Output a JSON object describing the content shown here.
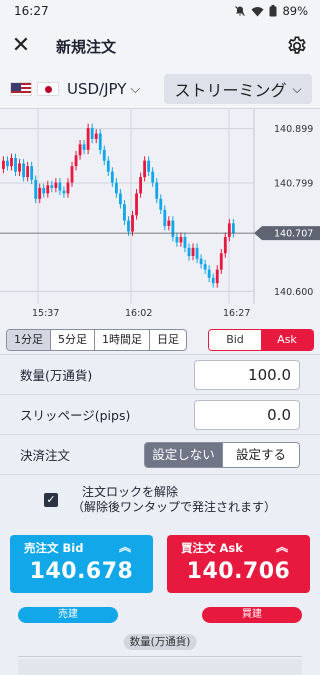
{
  "status_bar": {
    "time": "16:27",
    "battery": "89%"
  },
  "app_bar": {
    "title": "新規注文",
    "close_icon": "close-icon",
    "settings_icon": "gear-icon"
  },
  "pair_bar": {
    "pair": "USD/JPY",
    "mode": "ストリーミング"
  },
  "chart": {
    "price_ticks": [
      "140.899",
      "140.799",
      "140.707",
      "140.600"
    ],
    "time_ticks": [
      "15:37",
      "16:02",
      "16:27"
    ],
    "current_price": "140.707"
  },
  "chart_data": {
    "type": "candlestick",
    "y_ticks": [
      140.899,
      140.799,
      140.707,
      140.6
    ],
    "x_ticks": [
      "15:37",
      "16:02",
      "16:27"
    ],
    "current_price": 140.707,
    "colors": {
      "up": "#e8193f",
      "down": "#11a7e8"
    },
    "candles": [
      {
        "o": 140.825,
        "c": 140.84
      },
      {
        "o": 140.84,
        "c": 140.83
      },
      {
        "o": 140.83,
        "c": 140.845
      },
      {
        "o": 140.845,
        "c": 140.82
      },
      {
        "o": 140.82,
        "c": 140.835
      },
      {
        "o": 140.835,
        "c": 140.81
      },
      {
        "o": 140.81,
        "c": 140.83
      },
      {
        "o": 140.83,
        "c": 140.805
      },
      {
        "o": 140.805,
        "c": 140.77
      },
      {
        "o": 140.77,
        "c": 140.79
      },
      {
        "o": 140.79,
        "c": 140.78
      },
      {
        "o": 140.78,
        "c": 140.795
      },
      {
        "o": 140.795,
        "c": 140.79
      },
      {
        "o": 140.79,
        "c": 140.8
      },
      {
        "o": 140.8,
        "c": 140.785
      },
      {
        "o": 140.785,
        "c": 140.78
      },
      {
        "o": 140.78,
        "c": 140.8
      },
      {
        "o": 140.8,
        "c": 140.83
      },
      {
        "o": 140.83,
        "c": 140.85
      },
      {
        "o": 140.85,
        "c": 140.87
      },
      {
        "o": 140.87,
        "c": 140.86
      },
      {
        "o": 140.86,
        "c": 140.9
      },
      {
        "o": 140.9,
        "c": 140.88
      },
      {
        "o": 140.88,
        "c": 140.89
      },
      {
        "o": 140.89,
        "c": 140.86
      },
      {
        "o": 140.86,
        "c": 140.84
      },
      {
        "o": 140.84,
        "c": 140.82
      },
      {
        "o": 140.82,
        "c": 140.8
      },
      {
        "o": 140.8,
        "c": 140.78
      },
      {
        "o": 140.78,
        "c": 140.76
      },
      {
        "o": 140.76,
        "c": 140.73
      },
      {
        "o": 140.73,
        "c": 140.71
      },
      {
        "o": 140.71,
        "c": 140.74
      },
      {
        "o": 140.74,
        "c": 140.78
      },
      {
        "o": 140.78,
        "c": 140.81
      },
      {
        "o": 140.81,
        "c": 140.84
      },
      {
        "o": 140.84,
        "c": 140.82
      },
      {
        "o": 140.82,
        "c": 140.8
      },
      {
        "o": 140.8,
        "c": 140.77
      },
      {
        "o": 140.77,
        "c": 140.75
      },
      {
        "o": 140.75,
        "c": 140.72
      },
      {
        "o": 140.72,
        "c": 140.73
      },
      {
        "o": 140.73,
        "c": 140.7
      },
      {
        "o": 140.7,
        "c": 140.69
      },
      {
        "o": 140.69,
        "c": 140.7
      },
      {
        "o": 140.7,
        "c": 140.68
      },
      {
        "o": 140.68,
        "c": 140.665
      },
      {
        "o": 140.665,
        "c": 140.68
      },
      {
        "o": 140.68,
        "c": 140.66
      },
      {
        "o": 140.66,
        "c": 140.65
      },
      {
        "o": 140.65,
        "c": 140.64
      },
      {
        "o": 140.64,
        "c": 140.625
      },
      {
        "o": 140.625,
        "c": 140.615
      },
      {
        "o": 140.615,
        "c": 140.64
      },
      {
        "o": 140.64,
        "c": 140.67
      },
      {
        "o": 140.67,
        "c": 140.7
      },
      {
        "o": 140.7,
        "c": 140.725
      },
      {
        "o": 140.725,
        "c": 140.707
      }
    ]
  },
  "timeframes": [
    {
      "label": "1分足",
      "active": true
    },
    {
      "label": "5分足",
      "active": false
    },
    {
      "label": "1時間足",
      "active": false
    },
    {
      "label": "日足",
      "active": false
    }
  ],
  "bid_ask": {
    "bid": "Bid",
    "ask": "Ask"
  },
  "form": {
    "quantity": {
      "label": "数量(万通貨)",
      "value": "100.0"
    },
    "slippage": {
      "label": "スリッページ(pips)",
      "value": "0.0"
    },
    "settlement": {
      "label": "決済注文",
      "off": "設定しない",
      "on": "設定する"
    }
  },
  "order_lock": {
    "line1": "注文ロックを解除",
    "line2": "（解除後ワンタップで発注されます）"
  },
  "sell": {
    "label": "売注文 Bid",
    "price": "140.678",
    "sub": "売建"
  },
  "buy": {
    "label": "買注文 Ask",
    "price": "140.706",
    "sub": "買建"
  },
  "footer": {
    "qty_label": "数量(万通貨)"
  }
}
